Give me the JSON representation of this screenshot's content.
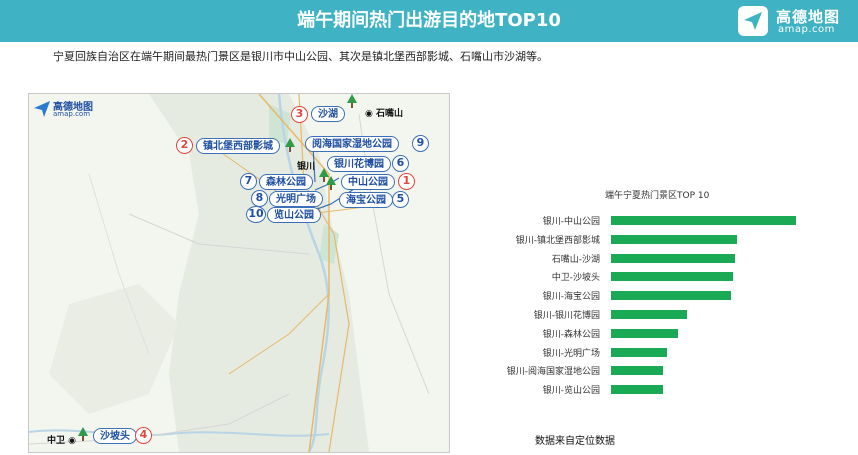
{
  "header": {
    "title": "端午期间热门出游目的地TOP10",
    "brand_cn": "高德地图",
    "brand_en": "amap.com",
    "color": "#3fb3c4"
  },
  "summary": "宁夏回族自治区在端午期间最热门景区是银川市中山公园、其次是镇北堡西部影城、石嘴山市沙湖等。",
  "map": {
    "logo_cn": "高德地图",
    "logo_en": "amap.com",
    "cities": [
      "石嘴山",
      "银川",
      "中卫"
    ],
    "labels": [
      {
        "rank": "1",
        "name": "中山公园"
      },
      {
        "rank": "2",
        "name": "镇北堡西部影城"
      },
      {
        "rank": "3",
        "name": "沙湖"
      },
      {
        "rank": "4",
        "name": "沙坡头"
      },
      {
        "rank": "5",
        "name": "海宝公园"
      },
      {
        "rank": "6",
        "name": "银川花博园"
      },
      {
        "rank": "7",
        "name": "森林公园"
      },
      {
        "rank": "8",
        "name": "光明广场"
      },
      {
        "rank": "9",
        "name": "阅海国家湿地公园"
      },
      {
        "rank": "10",
        "name": "览山公园"
      }
    ]
  },
  "chart_data": {
    "type": "bar",
    "orientation": "horizontal",
    "title": "端午宁夏热门景区TOP 10",
    "categories": [
      "银川-中山公园",
      "银川-镇北堡西部影城",
      "石嘴山-沙湖",
      "中卫-沙坡头",
      "银川-海宝公园",
      "银川-银川花博园",
      "银川-森林公园",
      "银川-光明广场",
      "银川-阅海国家湿地公园",
      "银川-览山公园"
    ],
    "values": [
      100,
      68,
      67,
      66,
      65,
      41,
      36,
      30,
      28,
      28
    ],
    "xlim": [
      0,
      100
    ],
    "bar_color": "#1aaa55",
    "grid": false
  },
  "source": "数据来自定位数据"
}
